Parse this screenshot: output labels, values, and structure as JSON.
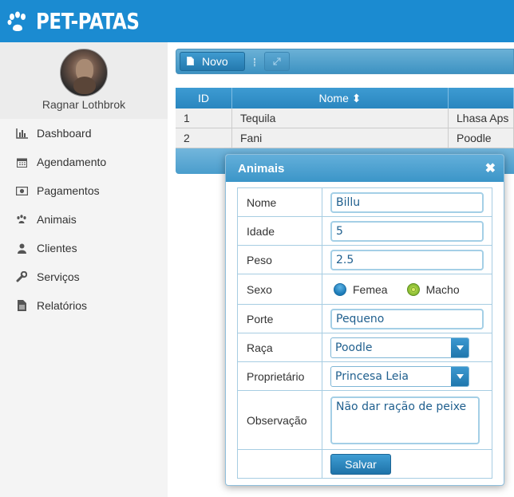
{
  "header": {
    "logo_text": "PET-PATAS",
    "logo_icon": "paw-icon"
  },
  "sidebar": {
    "user_name": "Ragnar Lothbrok",
    "items": [
      {
        "label": "Dashboard",
        "icon": "bar-chart-icon"
      },
      {
        "label": "Agendamento",
        "icon": "calendar-icon"
      },
      {
        "label": "Pagamentos",
        "icon": "money-icon"
      },
      {
        "label": "Animais",
        "icon": "paw-icon"
      },
      {
        "label": "Clientes",
        "icon": "user-icon"
      },
      {
        "label": "Serviços",
        "icon": "wrench-icon"
      },
      {
        "label": "Relatórios",
        "icon": "document-icon"
      }
    ]
  },
  "toolbar": {
    "novo_label": "Novo"
  },
  "grid": {
    "columns": [
      "ID",
      "Nome ⬍",
      ""
    ],
    "rows": [
      {
        "id": "1",
        "nome": "Tequila",
        "raca": "Lhasa Aps"
      },
      {
        "id": "2",
        "nome": "Fani",
        "raca": "Poodle"
      }
    ]
  },
  "dialog": {
    "title": "Animais",
    "labels": {
      "nome": "Nome",
      "idade": "Idade",
      "peso": "Peso",
      "sexo": "Sexo",
      "porte": "Porte",
      "raca": "Raça",
      "proprietario": "Proprietário",
      "observacao": "Observação"
    },
    "values": {
      "nome": "Billu",
      "idade": "5",
      "peso": "2.5",
      "porte": "Pequeno",
      "raca": "Poodle",
      "proprietario": "Princesa Leia",
      "observacao": "Não dar ração de peixe"
    },
    "sexo_options": [
      "Femea",
      "Macho"
    ],
    "sexo_selected": "Macho",
    "save_label": "Salvar"
  },
  "colors": {
    "header": "#1b8bd1",
    "accent": "#2a86bf"
  }
}
